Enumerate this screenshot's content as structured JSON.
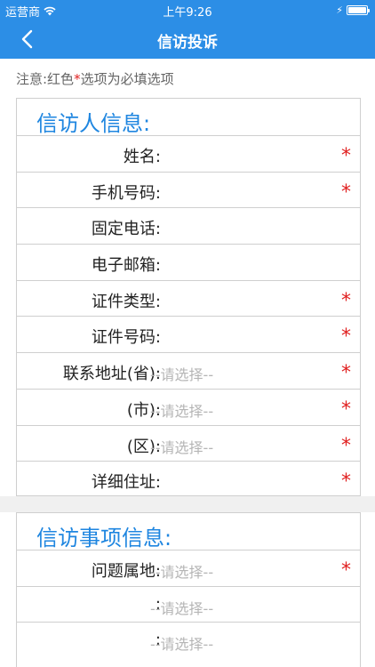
{
  "status_bar": {
    "carrier": "运营商",
    "time": "上午9:26"
  },
  "nav": {
    "title": "信访投诉"
  },
  "notice": {
    "prefix": "注意:红色",
    "star": "*",
    "suffix": "选项为必填选项"
  },
  "section_petitioner": {
    "title": "信访人信息:",
    "fields": [
      {
        "label": "姓名:",
        "value": "",
        "required": "*"
      },
      {
        "label": "手机号码:",
        "value": "",
        "required": "*"
      },
      {
        "label": "固定电话:",
        "value": "",
        "required": ""
      },
      {
        "label": "电子邮箱:",
        "value": "",
        "required": ""
      },
      {
        "label": "证件类型:",
        "value": "",
        "required": "*"
      },
      {
        "label": "证件号码:",
        "value": "",
        "required": "*"
      },
      {
        "label": "联系地址(省):",
        "value": "--请选择--",
        "required": "*"
      },
      {
        "label": "(市):",
        "value": "--请选择--",
        "required": "*"
      },
      {
        "label": "(区):",
        "value": "--请选择--",
        "required": "*"
      },
      {
        "label": "详细住址:",
        "value": "",
        "required": "*"
      }
    ]
  },
  "section_matter": {
    "title": "信访事项信息:",
    "fields": [
      {
        "label": "问题属地:",
        "value": "--请选择--",
        "required": "*"
      },
      {
        "label": ":",
        "value": "--请选择--",
        "required": ""
      },
      {
        "label": ":",
        "value": "--请选择--",
        "required": ""
      }
    ]
  },
  "colors": {
    "primary": "#2c8ee6",
    "section_title": "#1f86e0",
    "required": "#e02020",
    "placeholder": "#b5b5b5"
  }
}
